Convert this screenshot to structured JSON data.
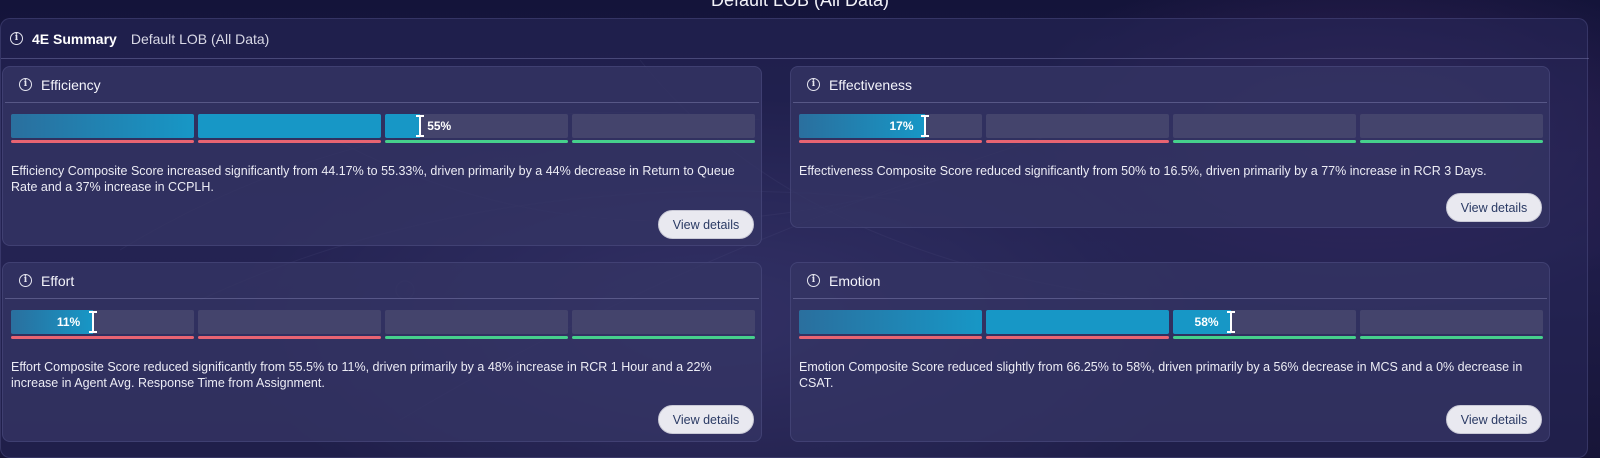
{
  "page_title": "Default LOB (All Data)",
  "summary": {
    "info_icon": "info-icon",
    "title": "4E Summary",
    "subtitle": "Default LOB (All Data)"
  },
  "colors": {
    "bar_fill": "#1797c6",
    "bar_track": "#44446c",
    "low_line": "#e86472",
    "high_line": "#46d08c",
    "button_bg": "#e9e9f0"
  },
  "cards": {
    "efficiency": {
      "title": "Efficiency",
      "score_percent": 55,
      "score_label": "55%",
      "description": "Efficiency Composite Score increased significantly from 44.17% to 55.33%, driven primarily by a 44% decrease in Return to Queue Rate and a 37% increase in CCPLH.",
      "button": "View details"
    },
    "effectiveness": {
      "title": "Effectiveness",
      "score_percent": 17,
      "score_label": "17%",
      "description": "Effectiveness Composite Score reduced significantly from 50% to 16.5%, driven primarily by a 77% increase in RCR 3 Days.",
      "button": "View details"
    },
    "effort": {
      "title": "Effort",
      "score_percent": 11,
      "score_label": "11%",
      "description": "Effort Composite Score reduced significantly from 55.5% to 11%, driven primarily by a 48% increase in RCR 1 Hour and a 22% increase in Agent Avg. Response Time from Assignment.",
      "button": "View details"
    },
    "emotion": {
      "title": "Emotion",
      "score_percent": 58,
      "score_label": "58%",
      "description": "Emotion Composite Score reduced slightly from 66.25% to 58%, driven primarily by a 56% decrease in MCS and a 0% decrease in CSAT.",
      "button": "View details"
    }
  }
}
